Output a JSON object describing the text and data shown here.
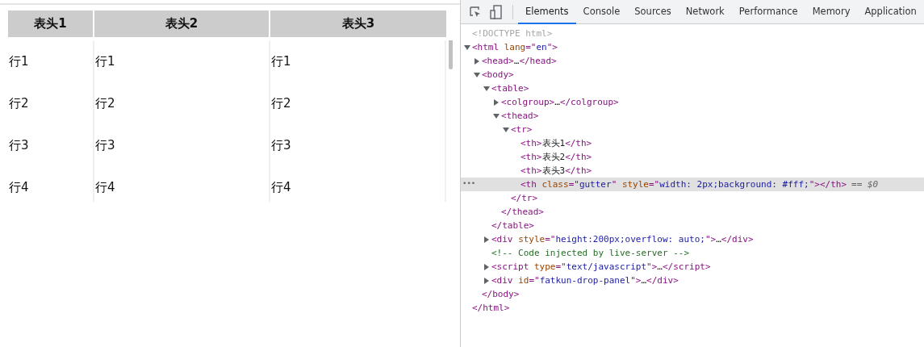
{
  "page": {
    "table": {
      "columns": [
        "表头1",
        "表头2",
        "表头3"
      ],
      "rows": [
        [
          "行1",
          "行1",
          "行1"
        ],
        [
          "行2",
          "行2",
          "行2"
        ],
        [
          "行3",
          "行3",
          "行3"
        ],
        [
          "行4",
          "行4",
          "行4"
        ]
      ]
    }
  },
  "devtools": {
    "tabs": [
      {
        "label": "Elements",
        "selected": true
      },
      {
        "label": "Console",
        "selected": false
      },
      {
        "label": "Sources",
        "selected": false
      },
      {
        "label": "Network",
        "selected": false
      },
      {
        "label": "Performance",
        "selected": false
      },
      {
        "label": "Memory",
        "selected": false
      },
      {
        "label": "Application",
        "selected": false
      }
    ],
    "dom_tree": [
      {
        "tokens": [
          {
            "kind": "doctype",
            "text": "<!DOCTYPE html>"
          }
        ]
      },
      {
        "tokens": [
          {
            "kind": "tag",
            "text": "<html "
          },
          {
            "kind": "attr",
            "text": "lang"
          },
          {
            "kind": "tag",
            "text": "=\""
          },
          {
            "kind": "value",
            "text": "en"
          },
          {
            "kind": "tag",
            "text": "\">"
          }
        ],
        "expanded": true,
        "closing": [
          {
            "kind": "tag",
            "text": "</html>"
          }
        ],
        "children": [
          {
            "tokens": [
              {
                "kind": "tag",
                "text": "<head>"
              },
              {
                "kind": "text",
                "text": "…"
              },
              {
                "kind": "tag",
                "text": "</head>"
              }
            ],
            "expanded": false
          },
          {
            "tokens": [
              {
                "kind": "tag",
                "text": "<body>"
              }
            ],
            "expanded": true,
            "closing": [
              {
                "kind": "tag",
                "text": "</body>"
              }
            ],
            "children": [
              {
                "tokens": [
                  {
                    "kind": "tag",
                    "text": "<table>"
                  }
                ],
                "expanded": true,
                "closing": [
                  {
                    "kind": "tag",
                    "text": "</table>"
                  }
                ],
                "children": [
                  {
                    "tokens": [
                      {
                        "kind": "tag",
                        "text": "<colgroup>"
                      },
                      {
                        "kind": "text",
                        "text": "…"
                      },
                      {
                        "kind": "tag",
                        "text": "</colgroup>"
                      }
                    ],
                    "expanded": false
                  },
                  {
                    "tokens": [
                      {
                        "kind": "tag",
                        "text": "<thead>"
                      }
                    ],
                    "expanded": true,
                    "closing": [
                      {
                        "kind": "tag",
                        "text": "</thead>"
                      }
                    ],
                    "children": [
                      {
                        "tokens": [
                          {
                            "kind": "tag",
                            "text": "<tr>"
                          }
                        ],
                        "expanded": true,
                        "closing": [
                          {
                            "kind": "tag",
                            "text": "</tr>"
                          }
                        ],
                        "children": [
                          {
                            "tokens": [
                              {
                                "kind": "tag",
                                "text": "<th>"
                              },
                              {
                                "kind": "text",
                                "text": "表头1"
                              },
                              {
                                "kind": "tag",
                                "text": "</th>"
                              }
                            ]
                          },
                          {
                            "tokens": [
                              {
                                "kind": "tag",
                                "text": "<th>"
                              },
                              {
                                "kind": "text",
                                "text": "表头2"
                              },
                              {
                                "kind": "tag",
                                "text": "</th>"
                              }
                            ]
                          },
                          {
                            "tokens": [
                              {
                                "kind": "tag",
                                "text": "<th>"
                              },
                              {
                                "kind": "text",
                                "text": "表头3"
                              },
                              {
                                "kind": "tag",
                                "text": "</th>"
                              }
                            ]
                          },
                          {
                            "tokens": [
                              {
                                "kind": "tag",
                                "text": "<th "
                              },
                              {
                                "kind": "attr",
                                "text": "class"
                              },
                              {
                                "kind": "tag",
                                "text": "=\""
                              },
                              {
                                "kind": "value",
                                "text": "gutter"
                              },
                              {
                                "kind": "tag",
                                "text": "\" "
                              },
                              {
                                "kind": "attr",
                                "text": "style"
                              },
                              {
                                "kind": "tag",
                                "text": "=\""
                              },
                              {
                                "kind": "value",
                                "text": "width: 2px;background: #fff;"
                              },
                              {
                                "kind": "tag",
                                "text": "\"></th>"
                              }
                            ],
                            "selected": true,
                            "marker": "== $0",
                            "menu": "•••"
                          }
                        ]
                      }
                    ]
                  }
                ]
              },
              {
                "tokens": [
                  {
                    "kind": "tag",
                    "text": "<div "
                  },
                  {
                    "kind": "attr",
                    "text": "style"
                  },
                  {
                    "kind": "tag",
                    "text": "=\""
                  },
                  {
                    "kind": "value",
                    "text": "height:200px;overflow: auto;"
                  },
                  {
                    "kind": "tag",
                    "text": "\">"
                  },
                  {
                    "kind": "text",
                    "text": "…"
                  },
                  {
                    "kind": "tag",
                    "text": "</div>"
                  }
                ],
                "expanded": false
              },
              {
                "tokens": [
                  {
                    "kind": "comment",
                    "text": "<!-- Code injected by live-server -->"
                  }
                ]
              },
              {
                "tokens": [
                  {
                    "kind": "tag",
                    "text": "<script "
                  },
                  {
                    "kind": "attr",
                    "text": "type"
                  },
                  {
                    "kind": "tag",
                    "text": "=\""
                  },
                  {
                    "kind": "value",
                    "text": "text/javascript"
                  },
                  {
                    "kind": "tag",
                    "text": "\">"
                  },
                  {
                    "kind": "text",
                    "text": "…"
                  },
                  {
                    "kind": "tag",
                    "text": "</script>"
                  }
                ],
                "expanded": false
              },
              {
                "tokens": [
                  {
                    "kind": "tag",
                    "text": "<div "
                  },
                  {
                    "kind": "attr",
                    "text": "id"
                  },
                  {
                    "kind": "tag",
                    "text": "=\""
                  },
                  {
                    "kind": "value",
                    "text": "fatkun-drop-panel"
                  },
                  {
                    "kind": "tag",
                    "text": "\">"
                  },
                  {
                    "kind": "text",
                    "text": "…"
                  },
                  {
                    "kind": "tag",
                    "text": "</div>"
                  }
                ],
                "expanded": false
              }
            ]
          }
        ]
      }
    ]
  }
}
